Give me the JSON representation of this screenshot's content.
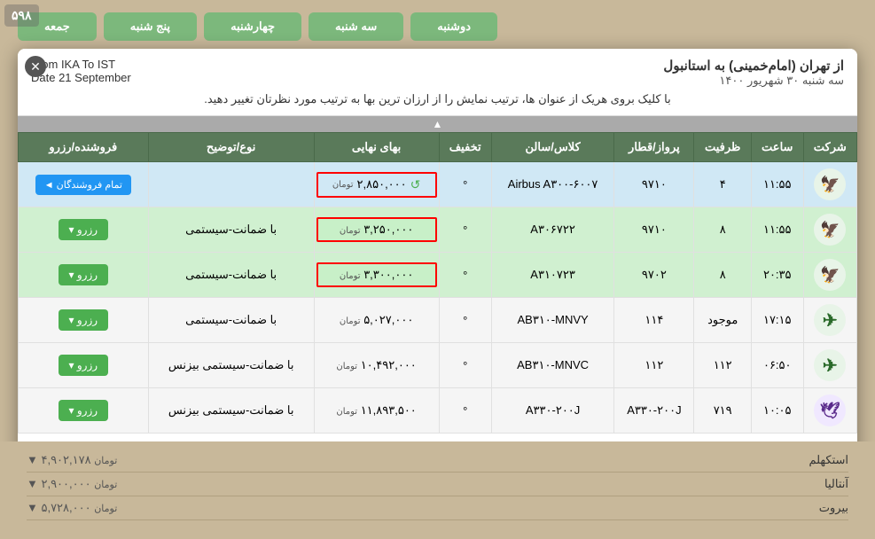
{
  "background": {
    "tabs": [
      {
        "label": "دوشنبه"
      },
      {
        "label": "سه شنبه"
      },
      {
        "label": "چهارشنبه"
      },
      {
        "label": "پنج شنبه"
      },
      {
        "label": "جمعه"
      }
    ]
  },
  "watermark": {
    "text": "۵۹۸"
  },
  "modal": {
    "close_label": "✕",
    "header": {
      "right_title": "از تهران (امام‌خمینی) به استانبول",
      "right_subtitle": "سه شنبه ۳۰ شهریور ۱۴۰۰",
      "left_line1": "From IKA To IST",
      "left_line2": "Date 21 September"
    },
    "sort_instruction": "با کلیک بروی هریک از عنوان ها، ترتیب نمایش را از ارزان ترین بها به ترتیب مورد نظرتان تغییر دهید.",
    "table": {
      "columns": [
        "شرکت",
        "ساعت",
        "ظرفیت",
        "پرواز/قطار",
        "کلاس/سالن",
        "تخفیف",
        "بهای نهایی",
        "نوع/توضیح",
        "فروشنده/رزرو"
      ],
      "rows": [
        {
          "company": "iran_air",
          "time": "۱۱:۵۵",
          "capacity": "۴",
          "flight": "۹۷۱۰",
          "class": "Airbus A۳۰۰-۶۰۰۷",
          "discount": "°",
          "price": "۲,۸۵۰,۰۰۰",
          "price_unit": "تومان",
          "description": "",
          "seller_type": "all",
          "highlight": true,
          "row_color": "blue"
        },
        {
          "company": "iran_air",
          "time": "۱۱:۵۵",
          "capacity": "۸",
          "flight": "۹۷۱۰",
          "class": "A۳۰۶۷۲۲",
          "discount": "°",
          "price": "۳,۲۵۰,۰۰۰",
          "price_unit": "تومان",
          "description": "با ضمانت-سیستمی",
          "seller_type": "reserve",
          "highlight": true,
          "row_color": "green"
        },
        {
          "company": "iran_air",
          "time": "۲۰:۳۵",
          "capacity": "۸",
          "flight": "۹۷۰۲",
          "class": "A۳۱۰۷۲۳",
          "discount": "°",
          "price": "۳,۳۰۰,۰۰۰",
          "price_unit": "تومان",
          "description": "با ضمانت-سیستمی",
          "seller_type": "reserve",
          "highlight": true,
          "row_color": "green"
        },
        {
          "company": "mahan",
          "time": "۱۷:۱۵",
          "capacity": "موجود",
          "flight": "۱۱۴",
          "class": "AB۳۱۰-MNVY",
          "discount": "°",
          "price": "۵,۰۲۷,۰۰۰",
          "price_unit": "تومان",
          "description": "با ضمانت-سیستمی",
          "seller_type": "reserve",
          "highlight": false,
          "row_color": "white"
        },
        {
          "company": "mahan",
          "time": "۰۶:۵۰",
          "capacity": "۱۱۲",
          "flight": "۱۱۲",
          "class": "AB۳۱۰-MNVC",
          "discount": "°",
          "price": "۱۰,۴۹۲,۰۰۰",
          "price_unit": "تومان",
          "description": "با ضمانت-سیستمی بیزنس",
          "seller_type": "reserve",
          "highlight": false,
          "row_color": "white"
        },
        {
          "company": "iran_air_tour",
          "time": "۱۰:۰۵",
          "capacity": "۷۱۹",
          "flight": "A۳۳۰-۲۰۰J",
          "class": "A۳۳۰-۲۰۰J",
          "discount": "°",
          "price": "۱۱,۸۹۳,۵۰۰",
          "price_unit": "تومان",
          "description": "با ضمانت-سیستمی بیزنس",
          "seller_type": "reserve",
          "highlight": false,
          "row_color": "white"
        }
      ]
    },
    "bottom_cities": [
      {
        "city": "استکهلم",
        "price": "۴,۹۰۲,۱۷۸",
        "unit": "تومان"
      },
      {
        "city": "آنتالیا",
        "price": "۲,۹۰۰,۰۰۰",
        "unit": "تومان"
      },
      {
        "city": "بیروت",
        "price": "۵,۷۲۸,۰۰۰",
        "unit": "تومان"
      }
    ]
  },
  "labels": {
    "reserve_btn": "رزرو ▾",
    "all_sellers_btn": "تمام فروشندگان ◄",
    "toman": "تومان"
  }
}
